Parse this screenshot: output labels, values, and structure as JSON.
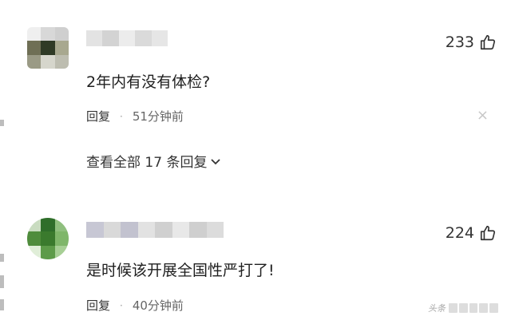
{
  "comments": [
    {
      "likes": "233",
      "text": "2年内有没有体检?",
      "reply_label": "回复",
      "separator": "·",
      "time": "51分钟前",
      "close_glyph": "×",
      "view_all": "查看全部 17 条回复",
      "avatar_colors": [
        "#efefef",
        "#d8d8d8",
        "#cfcfcf",
        "#6f6f55",
        "#2f3a25",
        "#a8a88f",
        "#9a9a85",
        "#d6d6cc",
        "#bdbdb0"
      ]
    },
    {
      "likes": "224",
      "text": "是时候该开展全国性严打了!",
      "reply_label": "回复",
      "separator": "·",
      "time": "40分钟前",
      "avatar_colors": [
        "#c9dcc0",
        "#2f6e2a",
        "#8fbf7e",
        "#4f8c3c",
        "#3a7a2d",
        "#7fb66a",
        "#e0eed8",
        "#5d9b49",
        "#a7cf95"
      ]
    }
  ],
  "watermark": {
    "prefix": "头条"
  },
  "icons": {
    "like": "thumb-up-icon",
    "expand": "chevron-down-icon",
    "close": "close-icon"
  },
  "colors": {
    "text": "#1f1f1f",
    "meta": "#666666",
    "background": "#ffffff"
  }
}
